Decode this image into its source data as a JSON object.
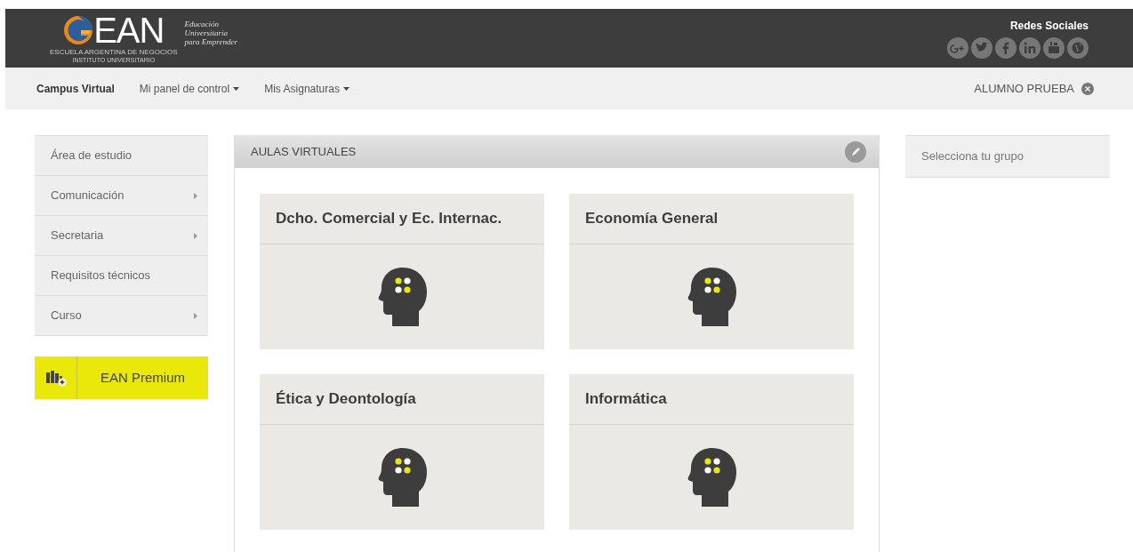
{
  "header": {
    "logo": {
      "wordmark": "EAN",
      "tagline": [
        "Educación",
        "Universitaria",
        "para Emprender"
      ],
      "subtitle": [
        "ESCUELA ARGENTINA DE NEGOCIOS",
        "INSTITUTO UNIVERSITARIO"
      ]
    },
    "social_title": "Redes Sociales",
    "social": [
      {
        "kind": "googleplus"
      },
      {
        "kind": "twitter"
      },
      {
        "kind": "facebook"
      },
      {
        "kind": "linkedin"
      },
      {
        "kind": "youtube"
      },
      {
        "kind": "web"
      }
    ]
  },
  "nav": {
    "items": [
      {
        "label": "Campus Virtual",
        "dropdown": false,
        "selected": true
      },
      {
        "label": "Mi panel de control",
        "dropdown": true,
        "selected": false
      },
      {
        "label": "Mis Asignaturas",
        "dropdown": true,
        "selected": false
      }
    ],
    "user": "ALUMNO PRUEBA"
  },
  "sidebar": {
    "items": [
      {
        "label": "Área de estudio",
        "submenu": false
      },
      {
        "label": "Comunicación",
        "submenu": true
      },
      {
        "label": "Secretaria",
        "submenu": true
      },
      {
        "label": "Requisitos técnicos",
        "submenu": false
      },
      {
        "label": "Curso",
        "submenu": true
      }
    ],
    "premium": "EAN Premium"
  },
  "main": {
    "title": "AULAS VIRTUALES",
    "courses": [
      {
        "title": "Dcho. Comercial y Ec. Internac."
      },
      {
        "title": "Economía General"
      },
      {
        "title": "Ética y Deontología"
      },
      {
        "title": "Informática"
      }
    ]
  },
  "right": {
    "group_label": "Selecciona tu grupo"
  }
}
